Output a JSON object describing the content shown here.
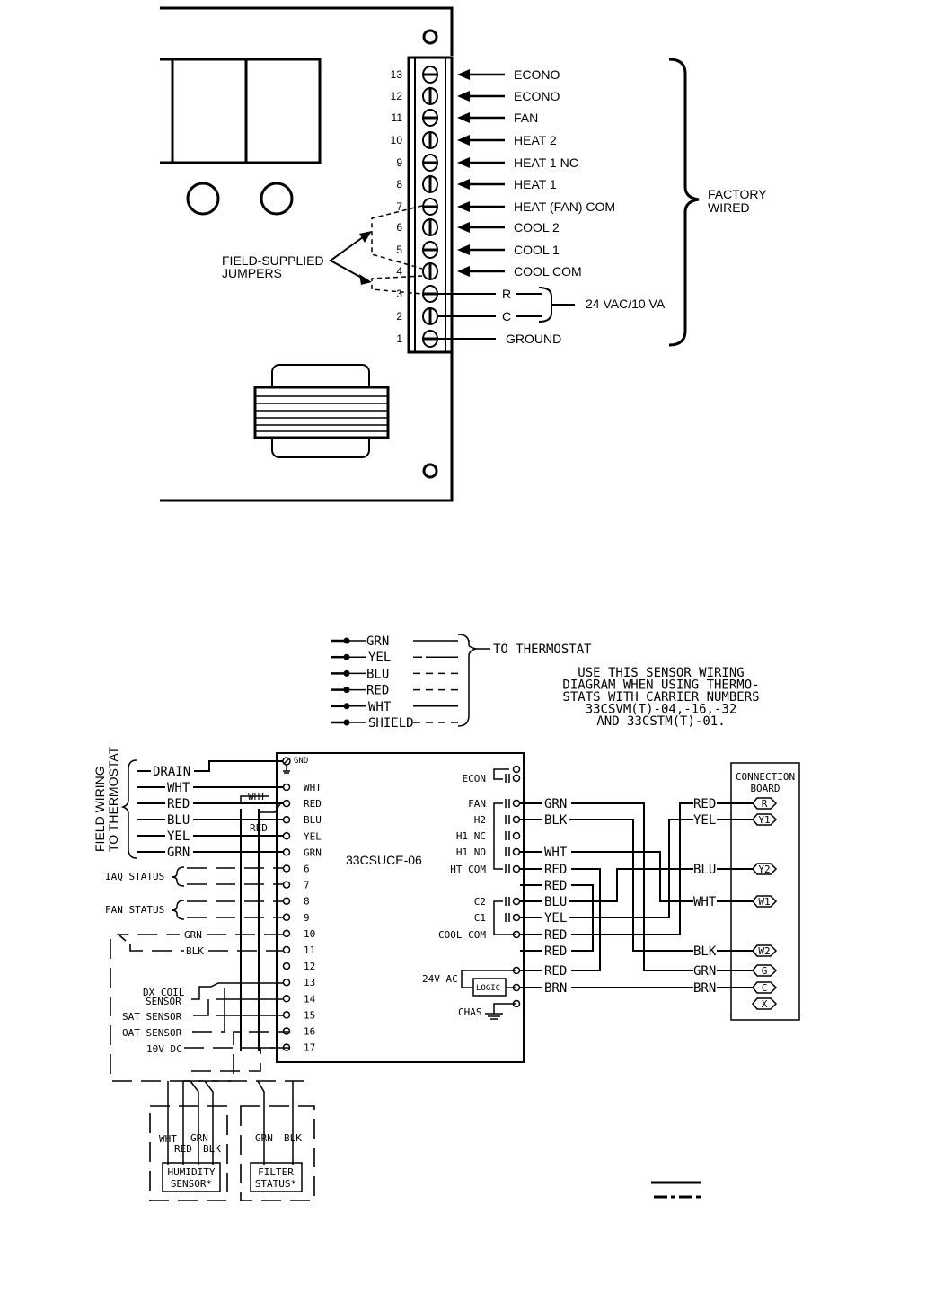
{
  "top_diagram": {
    "terminals": [
      {
        "num": "13",
        "label": "ECONO"
      },
      {
        "num": "12",
        "label": "ECONO"
      },
      {
        "num": "11",
        "label": "FAN"
      },
      {
        "num": "10",
        "label": "HEAT 2"
      },
      {
        "num": "9",
        "label": "HEAT 1 NC"
      },
      {
        "num": "8",
        "label": "HEAT 1"
      },
      {
        "num": "7",
        "label": "HEAT (FAN) COM"
      },
      {
        "num": "6",
        "label": "COOL 2"
      },
      {
        "num": "5",
        "label": "COOL 1"
      },
      {
        "num": "4",
        "label": "COOL COM"
      },
      {
        "num": "3",
        "label": "R"
      },
      {
        "num": "2",
        "label": "C"
      },
      {
        "num": "1",
        "label": "GROUND"
      }
    ],
    "jumpers_label_1": "FIELD-SUPPLIED",
    "jumpers_label_2": "JUMPERS",
    "power_label": "24 VAC/10 VA",
    "factory_label_1": "FACTORY",
    "factory_label_2": "WIRED"
  },
  "legend": {
    "wires": [
      "GRN",
      "YEL",
      "BLU",
      "RED",
      "WHT",
      "SHIELD"
    ],
    "to_label": "TO THERMOSTAT",
    "note_lines": [
      "USE THIS SENSOR WIRING",
      "DIAGRAM WHEN USING THERMO-",
      "STATS WITH CARRIER NUMBERS",
      "33CSVM(T)-04,-16,-32",
      "AND 33CSTM(T)-01."
    ]
  },
  "controller": {
    "model": "33CSUCE-06",
    "gnd_label": "GND",
    "left_terminals": [
      "WHT",
      "RED",
      "BLU",
      "YEL",
      "GRN",
      "6",
      "7",
      "8",
      "9",
      "10",
      "11",
      "12",
      "13",
      "14",
      "15",
      "16",
      "17"
    ],
    "right_terminals": [
      "ECON",
      "FAN",
      "H2",
      "H1 NC",
      "H1 NO",
      "HT COM",
      "C2",
      "C1",
      "COOL COM",
      "24V AC",
      "CHAS"
    ],
    "logic_label": "LOGIC"
  },
  "field_wiring": {
    "side_label_1": "FIELD WIRING",
    "side_label_2": "TO THERMOSTAT",
    "wires": [
      "DRAIN",
      "WHT",
      "RED",
      "BLU",
      "YEL",
      "GRN"
    ],
    "jumper_wht": "WHT",
    "jumper_red": "RED",
    "iaq_label": "IAQ STATUS",
    "fan_label": "FAN STATUS",
    "grn": "GRN",
    "blk": "BLK",
    "dx_label_1": "DX COIL",
    "dx_label_2": "SENSOR",
    "sat_label": "SAT SENSOR",
    "oat_label": "OAT SENSOR",
    "v10_label": "10V DC"
  },
  "sensors": {
    "humidity_wires": [
      "WHT",
      "RED",
      "GRN",
      "BLK"
    ],
    "humidity_label_1": "HUMIDITY",
    "humidity_label_2": "SENSOR*",
    "filter_wires": [
      "GRN",
      "BLK"
    ],
    "filter_label_1": "FILTER",
    "filter_label_2": "STATUS*"
  },
  "output_wires": {
    "left": [
      "GRN",
      "BLK",
      "WHT",
      "RED",
      "RED",
      "BLU",
      "YEL",
      "RED",
      "RED",
      "RED",
      "BRN"
    ],
    "right": [
      "RED",
      "YEL",
      "BLU",
      "WHT",
      "BLK",
      "GRN",
      "BRN"
    ]
  },
  "connection_board": {
    "title_1": "CONNECTION",
    "title_2": "BOARD",
    "terminals": [
      "R",
      "Y1",
      "Y2",
      "W1",
      "W2",
      "G",
      "C",
      "X"
    ]
  }
}
